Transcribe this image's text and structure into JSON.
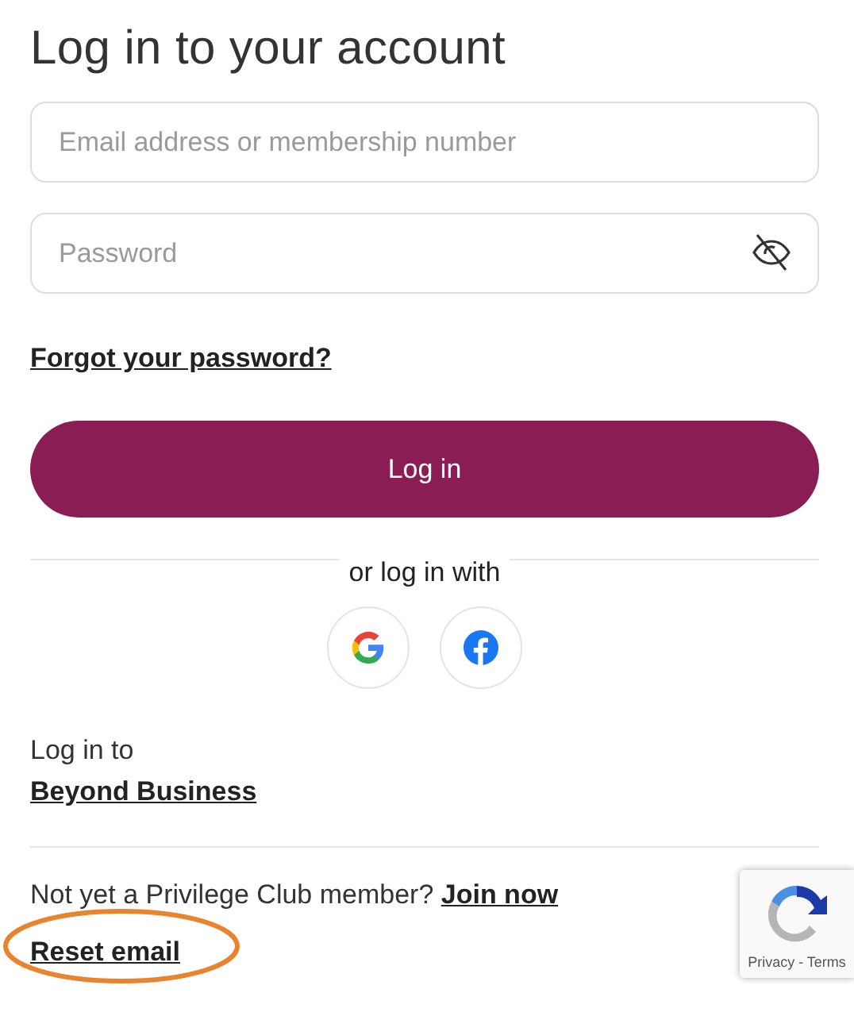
{
  "title": "Log in to your account",
  "fields": [
    {
      "kind": "text",
      "placeholder": "Email address or membership number"
    },
    {
      "kind": "password",
      "placeholder": "Password"
    }
  ],
  "forgot_link": "Forgot your password?",
  "login_button": "Log in",
  "divider_text": "or log in with",
  "social": [
    {
      "kind": "google"
    },
    {
      "kind": "facebook"
    }
  ],
  "business": {
    "label": "Log in to",
    "link": "Beyond Business"
  },
  "signup": {
    "text": "Not yet a Privilege Club member?",
    "link": "Join now"
  },
  "reset": {
    "label": "Reset email",
    "circled": true
  },
  "recaptcha": {
    "links": "Privacy - Terms"
  }
}
